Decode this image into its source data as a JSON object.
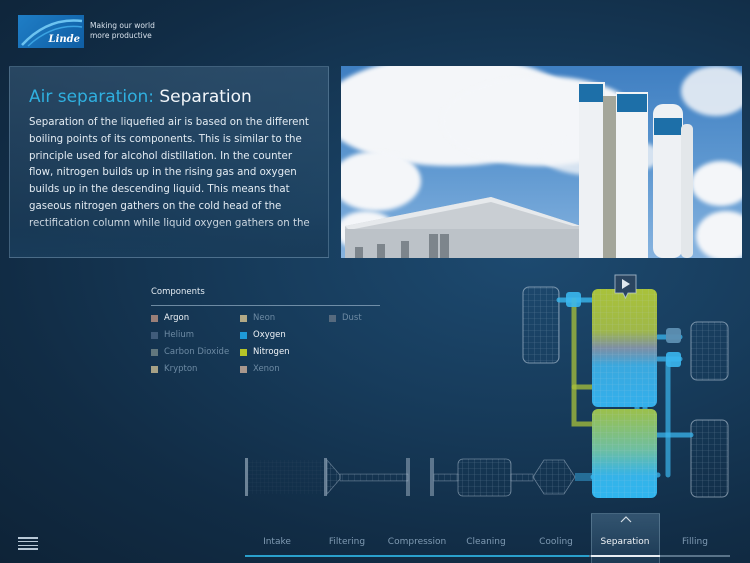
{
  "brand": {
    "logo_text": "Linde",
    "tagline_line1": "Making our world",
    "tagline_line2": "more productive",
    "accent_color": "#2fb0e0"
  },
  "info": {
    "title_prefix": "Air separation:",
    "title_main": "Separation",
    "body": "Separation of the liquefied air is based on the different boiling points of its components. This is similar to the principle used for alcohol distillation. In the counter flow, nitrogen builds up in the rising gas and oxygen builds up in the descending liquid. This means that gaseous nitrogen gathers on the cold head of the rectification column while liquid oxygen gathers on the"
  },
  "photo": {
    "description": "Air separation plant with white towers bearing Linde logos under a cloudy blue sky",
    "icon": "photo"
  },
  "components": {
    "title": "Components",
    "items": [
      {
        "label": "Argon",
        "color": "#9a7f78",
        "active": true
      },
      {
        "label": "Helium",
        "color": "#4f6a88",
        "active": false
      },
      {
        "label": "Carbon Dioxide",
        "color": "#7c8f8c",
        "active": false
      },
      {
        "label": "Krypton",
        "color": "#d8c79a",
        "active": false
      },
      {
        "label": "Neon",
        "color": "#e6cf96",
        "active": false
      },
      {
        "label": "Oxygen",
        "color": "#1e9ad8",
        "active": true
      },
      {
        "label": "Nitrogen",
        "color": "#b5c428",
        "active": true
      },
      {
        "label": "Xenon",
        "color": "#d9b8a0",
        "active": false
      },
      {
        "label": "Dust",
        "color": "#6b7a88",
        "active": false
      }
    ]
  },
  "diagram": {
    "play_icon": "play-icon",
    "oxygen_color": "#3ab6ee",
    "nitrogen_color": "#a9c23a"
  },
  "nav": {
    "tabs": [
      "Intake",
      "Filtering",
      "Compression",
      "Cleaning",
      "Cooling",
      "Separation",
      "Filling"
    ],
    "active_index": 5,
    "progress_fraction": 0.71,
    "chevron_icon": "chevron-up-icon",
    "menu_icon": "hamburger-menu-icon"
  }
}
